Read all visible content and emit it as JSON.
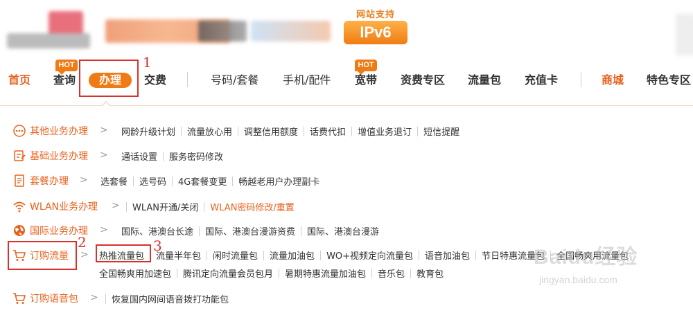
{
  "header": {
    "ipv6_caption": "网站支持",
    "ipv6_badge": "IPv6"
  },
  "nav": {
    "items": [
      {
        "label": "首页"
      },
      {
        "label": "查询",
        "hot": "HOT"
      },
      {
        "label": "办理"
      },
      {
        "label": "交费"
      },
      {
        "label": "号码/套餐"
      },
      {
        "label": "手机/配件"
      },
      {
        "label": "宽带",
        "hot": "HOT"
      },
      {
        "label": "资费专区"
      },
      {
        "label": "流量包"
      },
      {
        "label": "充值卡"
      },
      {
        "label": "商城"
      },
      {
        "label": "特色专区"
      }
    ]
  },
  "annotations": [
    "1",
    "2",
    "3"
  ],
  "menu": {
    "rows": [
      {
        "category": "其他业务办理",
        "links": [
          "网龄升级计划",
          "流量放心用",
          "调整信用额度",
          "话费代扣",
          "增值业务退订",
          "短信提醒"
        ]
      },
      {
        "category": "基础业务办理",
        "links": [
          "通话设置",
          "服务密码修改"
        ]
      },
      {
        "category": "套餐办理",
        "links": [
          "选套餐",
          "选号码",
          "4G套餐变更",
          "畅越老用户办理副卡"
        ]
      },
      {
        "category": "WLAN业务办理",
        "links": [
          "WLAN开通/关闭",
          "WLAN密码修改/重置"
        ]
      },
      {
        "category": "国际业务办理",
        "links": [
          "国际、港澳台长途",
          "国际、港澳台漫游资费",
          "国际、港澳台漫游"
        ]
      },
      {
        "category": "订购流量",
        "links": [
          "热推流量包",
          "流量半年包",
          "闲时流量包",
          "流量加油包",
          "WO+视频定向流量包",
          "语音加油包",
          "节日特惠流量包",
          "全国畅爽用流量包"
        ],
        "links2": [
          "全国畅爽用加速包",
          "腾讯定向流量会员包月",
          "暑期特惠流量加油包",
          "音乐包",
          "教育包"
        ]
      },
      {
        "category": "订购语音包",
        "links": [
          "恢复国内网间语音拨打功能包"
        ]
      }
    ]
  },
  "watermark": {
    "main": "Baidu经验",
    "sub": "jingyan.baidu.com"
  },
  "colors": {
    "accent": "#f07a14",
    "category_text": "#e8601c",
    "annotation_red": "#d9302c"
  }
}
